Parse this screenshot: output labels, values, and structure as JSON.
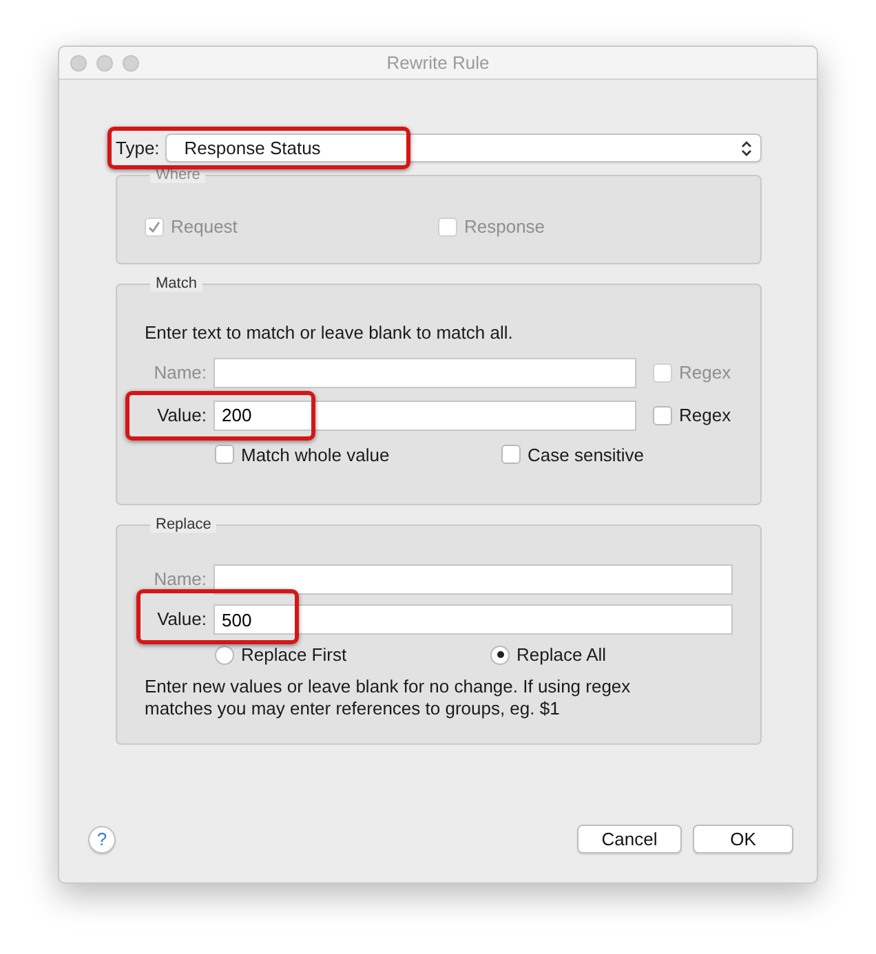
{
  "window": {
    "title": "Rewrite Rule"
  },
  "type": {
    "label": "Type:",
    "value": "Response Status",
    "highlighted": true
  },
  "where": {
    "title": "Where",
    "disabled": true,
    "options": [
      {
        "label": "Request",
        "checked": true
      },
      {
        "label": "Response",
        "checked": false
      }
    ]
  },
  "match": {
    "title": "Match",
    "instructions": "Enter text to match or leave blank to match all.",
    "fields": [
      {
        "label": "Name:",
        "disabled": true,
        "highlighted": false,
        "regex": {
          "label": "Regex",
          "checked": false,
          "disabled": true
        }
      },
      {
        "label": "Value:",
        "value": "200",
        "disabled": false,
        "highlighted": true,
        "regex": {
          "label": "Regex",
          "checked": false,
          "disabled": false
        }
      }
    ],
    "options": [
      {
        "label": "Match whole value",
        "checked": false
      },
      {
        "label": "Case sensitive",
        "checked": false
      }
    ]
  },
  "replace": {
    "title": "Replace",
    "fields": [
      {
        "label": "Name:",
        "disabled": true,
        "highlighted": false
      },
      {
        "label": "Value:",
        "value": "500",
        "disabled": false,
        "highlighted": true
      }
    ],
    "modes": [
      {
        "label": "Replace First",
        "selected": false
      },
      {
        "label": "Replace All",
        "selected": true
      }
    ],
    "note": "Enter new values or leave blank for no change. If using regex matches you may enter references to groups, eg. $1"
  },
  "footer": {
    "help": "?",
    "buttons": [
      {
        "label": "Cancel"
      },
      {
        "label": "OK"
      }
    ]
  }
}
